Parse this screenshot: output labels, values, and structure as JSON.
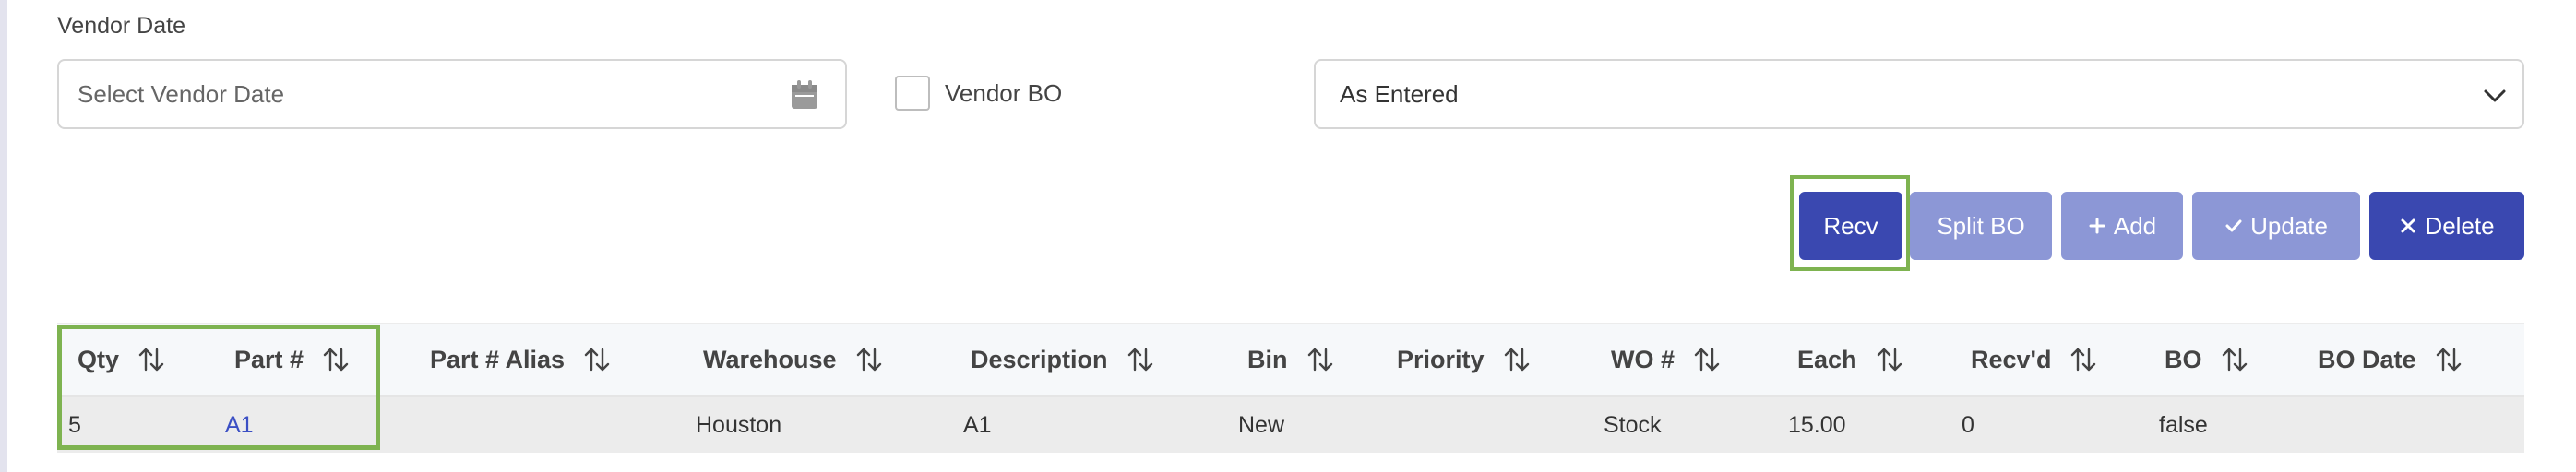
{
  "vendor_date": {
    "label": "Vendor Date",
    "placeholder": "Select Vendor Date"
  },
  "vendor_bo": {
    "label": "Vendor BO",
    "checked": false
  },
  "receive_mode": {
    "selected": "As Entered"
  },
  "actions": {
    "recv": "Recv",
    "split_bo": "Split BO",
    "add": "Add",
    "update": "Update",
    "delete": "Delete"
  },
  "colors": {
    "primary": "#3a48b0",
    "primary_disabled": "#8c97d6",
    "highlight": "#7eb350",
    "link": "#3b4fc4"
  },
  "table": {
    "columns": [
      "Qty",
      "Part #",
      "Part # Alias",
      "Warehouse",
      "Description",
      "Bin",
      "Priority",
      "WO #",
      "Each",
      "Recv'd",
      "BO",
      "BO Date"
    ],
    "rows": [
      [
        "5",
        "A1",
        "",
        "Houston",
        "A1",
        "New",
        "",
        "Stock",
        "15.00",
        "0",
        "false",
        ""
      ]
    ]
  }
}
